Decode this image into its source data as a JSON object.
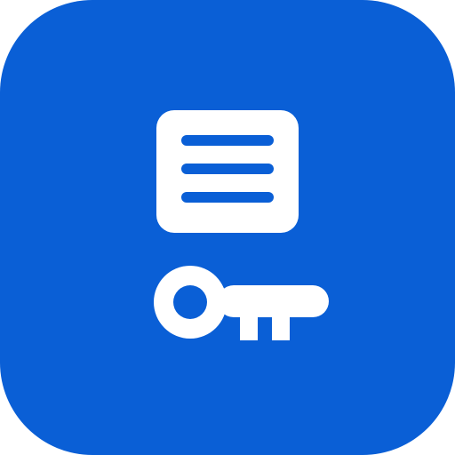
{
  "icon": {
    "name": "password-manager-app-icon",
    "colors": {
      "background": "#0a5fd6",
      "foreground": "#ffffff"
    },
    "glyphs": [
      "document-lines-icon",
      "key-icon"
    ]
  }
}
